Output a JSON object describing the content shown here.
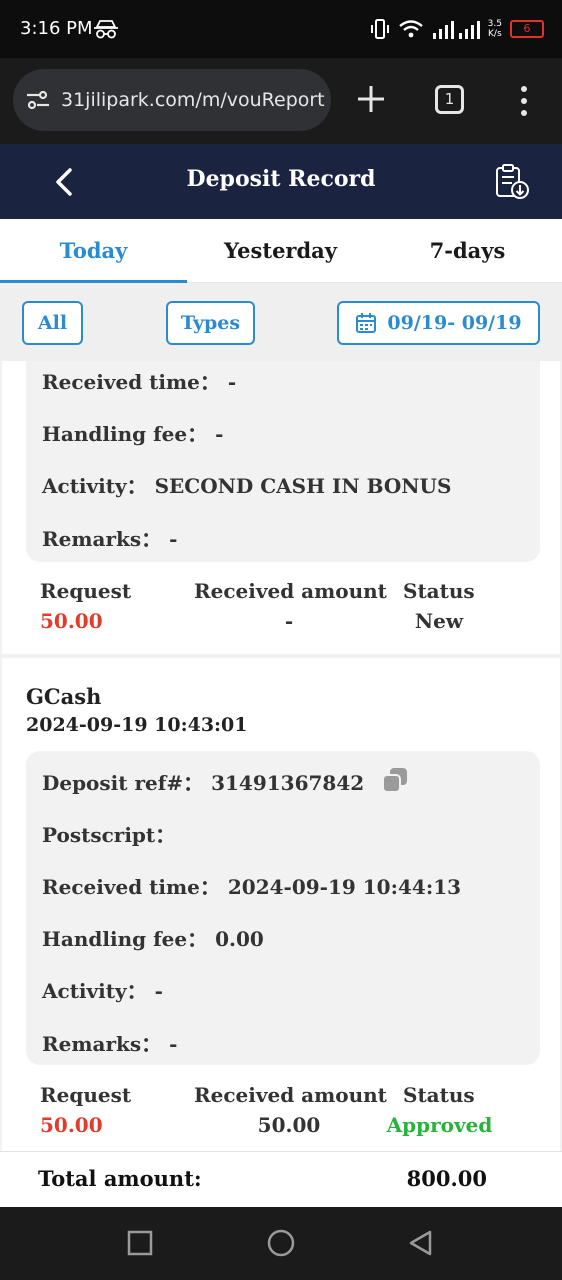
{
  "status_bar": {
    "time": "3:16 PM",
    "speed_top": "3.5",
    "speed_bottom": "K/s",
    "battery": "6"
  },
  "browser": {
    "url": "31jilipark.com/m/vouReport",
    "tab_count": "1"
  },
  "header": {
    "title": "Deposit Record"
  },
  "tabs": [
    {
      "label": "Today",
      "active": true
    },
    {
      "label": "Yesterday",
      "active": false
    },
    {
      "label": "7-days",
      "active": false
    }
  ],
  "filters": {
    "all_label": "All",
    "types_label": "Types",
    "date_range": "09/19- 09/19"
  },
  "records": [
    {
      "details": [
        {
          "label": "Received time：",
          "value": "-"
        },
        {
          "label": "Handling fee：",
          "value": "-"
        },
        {
          "label": "Activity：",
          "value": "SECOND CASH IN BONUS"
        },
        {
          "label": "Remarks：",
          "value": "-"
        }
      ],
      "headers": {
        "request": "Request",
        "received": "Received amount",
        "status": "Status"
      },
      "request": "50.00",
      "received_amount": "-",
      "status": "New"
    },
    {
      "method": "GCash",
      "datetime": "2024-09-19 10:43:01",
      "details": [
        {
          "label": "Deposit ref#：",
          "value": "31491367842"
        },
        {
          "label": "Postscript：",
          "value": ""
        },
        {
          "label": "Received time：",
          "value": "2024-09-19 10:44:13"
        },
        {
          "label": "Handling fee：",
          "value": "0.00"
        },
        {
          "label": "Activity：",
          "value": "-"
        },
        {
          "label": "Remarks：",
          "value": "-"
        }
      ],
      "headers": {
        "request": "Request",
        "received": "Received amount",
        "status": "Status"
      },
      "request": "50.00",
      "received_amount": "50.00",
      "status": "Approved"
    }
  ],
  "total": {
    "label": "Total amount:",
    "value": "800.00"
  },
  "colors": {
    "header_bg": "#1a2340",
    "accent": "#2a8bd1",
    "request_red": "#e13c2a",
    "approved_green": "#27b33a"
  }
}
